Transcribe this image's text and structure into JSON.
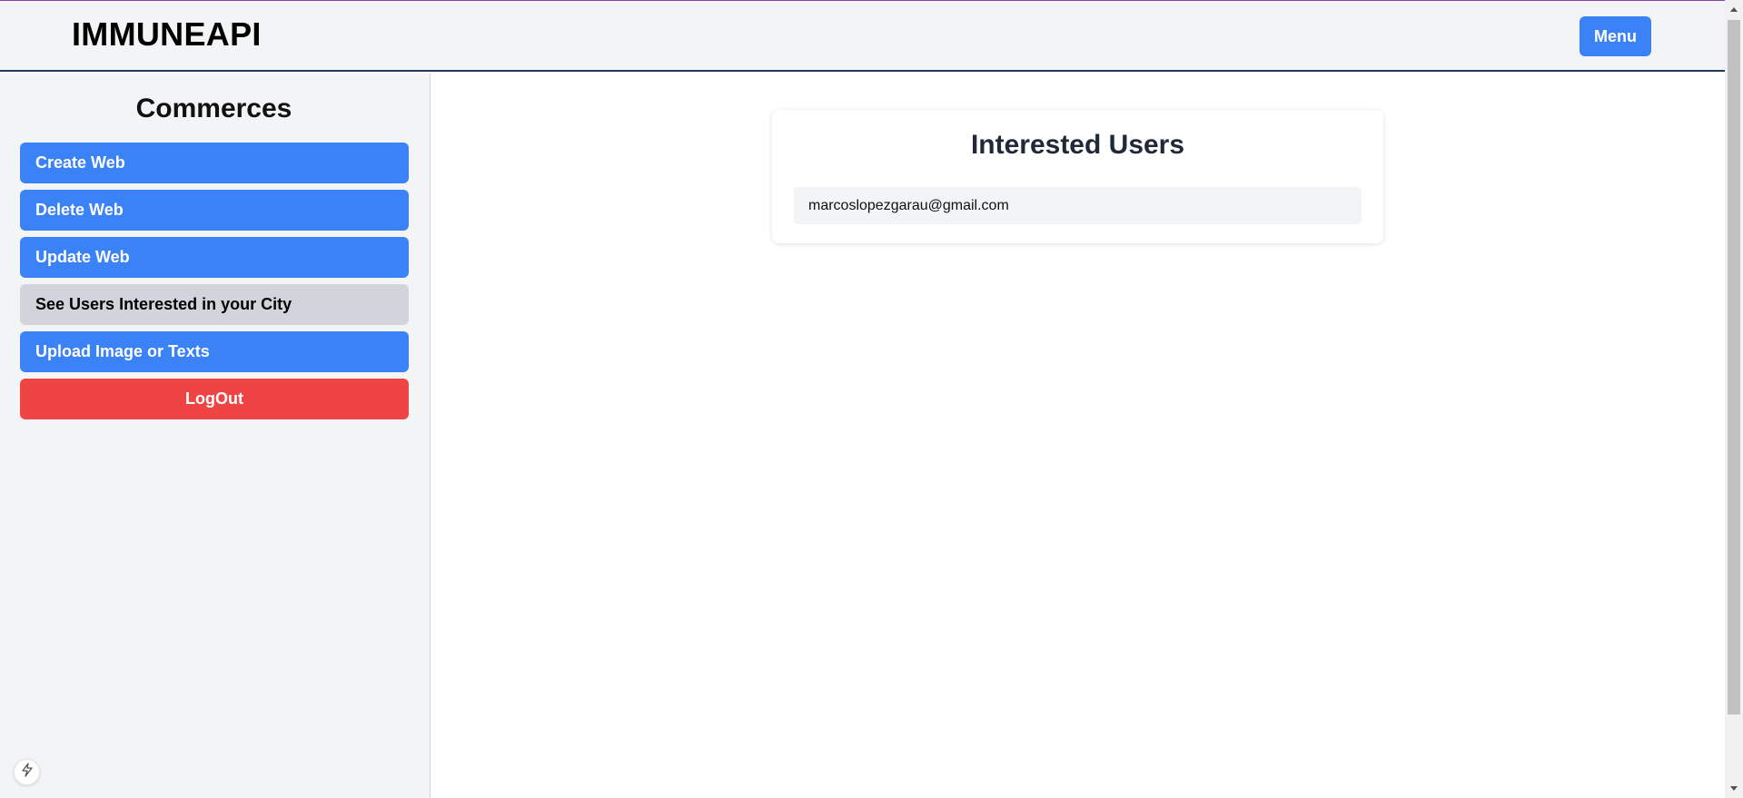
{
  "header": {
    "brand": "IMMUNEAPI",
    "menu_label": "Menu"
  },
  "sidebar": {
    "title": "Commerces",
    "items": [
      {
        "label": "Create Web",
        "style": "blue"
      },
      {
        "label": "Delete Web",
        "style": "blue"
      },
      {
        "label": "Update Web",
        "style": "blue"
      },
      {
        "label": "See Users Interested in your City",
        "style": "gray",
        "active": true
      },
      {
        "label": "Upload Image or Texts",
        "style": "blue"
      }
    ],
    "logout_label": "LogOut"
  },
  "main": {
    "card_title": "Interested Users",
    "users": [
      "marcoslopezgarau@gmail.com"
    ]
  },
  "colors": {
    "primary": "#3b82f6",
    "danger": "#ef4444",
    "active": "#d1d5db",
    "sidebar_bg": "#f3f4f6"
  },
  "icons": {
    "floating_button": "lightning-bolt-icon"
  }
}
